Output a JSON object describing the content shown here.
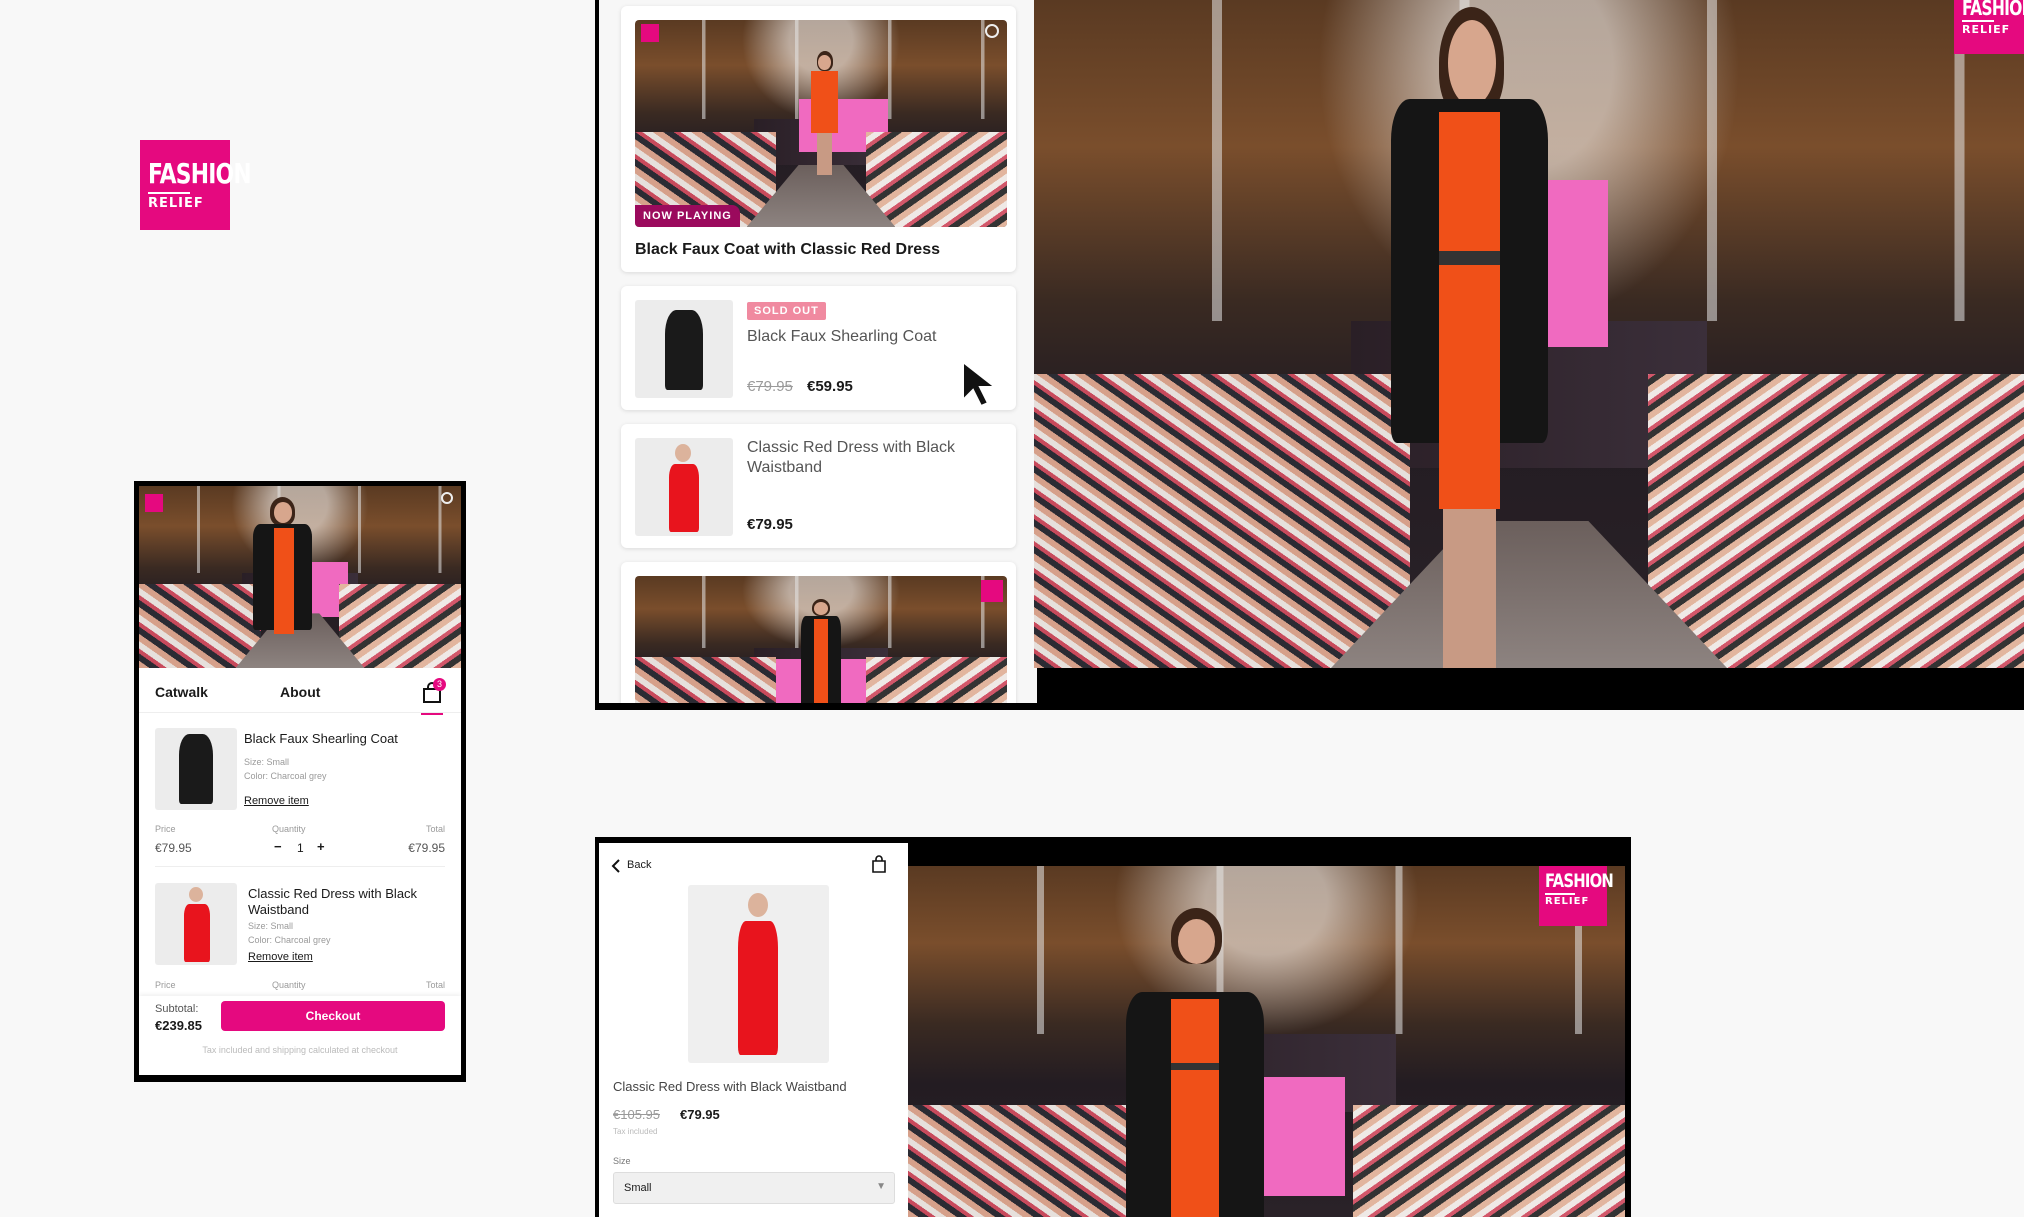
{
  "colors": {
    "brand": "#e5097f",
    "sold_out": "#f08aa0",
    "text": "#1a1a1a",
    "muted": "#9a9a9a"
  },
  "brand": {
    "line1": "FASHION",
    "line2": "RELIEF"
  },
  "video_panel": {
    "now_playing": "NOW PLAYING",
    "featured_title": "Black Faux Coat with Classic Red Dress",
    "items": [
      {
        "badge": "SOLD OUT",
        "name": "Black Faux Shearling Coat",
        "old_price": "€79.95",
        "price": "€59.95"
      },
      {
        "name": "Classic Red Dress with Black Waistband",
        "price": "€79.95"
      }
    ]
  },
  "cart": {
    "tabs": [
      "Catwalk",
      "About"
    ],
    "badge_count": "3",
    "items": [
      {
        "name": "Black Faux Shearling Coat",
        "size": "Size: Small",
        "color": "Color: Charcoal grey",
        "remove": "Remove item",
        "price_label": "Price",
        "qty_label": "Quantity",
        "total_label": "Total",
        "price": "€79.95",
        "qty": "1",
        "total": "€79.95"
      },
      {
        "name": "Classic Red Dress with Black Waistband",
        "size": "Size: Small",
        "color": "Color: Charcoal grey",
        "remove": "Remove item",
        "price_label": "Price",
        "qty_label": "Quantity",
        "total_label": "Total"
      }
    ],
    "subtotal_label": "Subtotal:",
    "subtotal": "€239.85",
    "checkout": "Checkout",
    "tax_note": "Tax included and shipping calculated at checkout",
    "minus": "−",
    "plus": "+"
  },
  "product_detail": {
    "back": "Back",
    "name": "Classic Red Dress with Black Waistband",
    "old_price": "€105.95",
    "price": "€79.95",
    "tax": "Tax included",
    "size_label": "Size",
    "size_value": "Small"
  }
}
